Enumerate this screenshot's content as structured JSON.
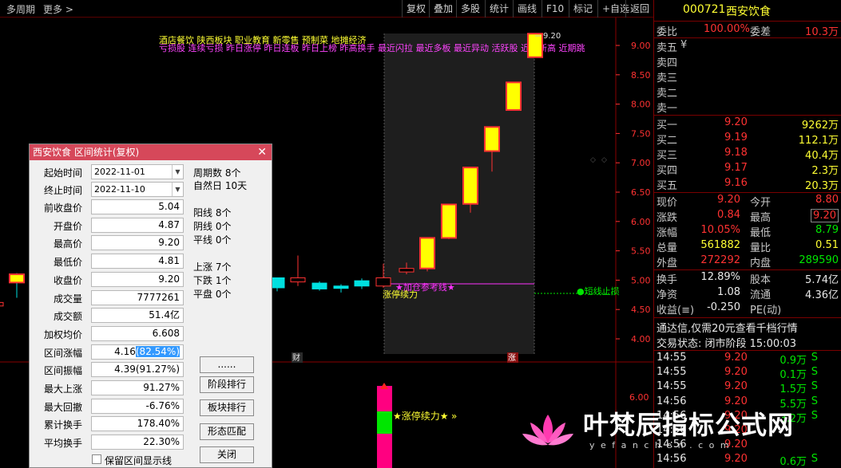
{
  "toolbar": {
    "period": "多周期",
    "more": "更多",
    "more_icon": "chevron-right-icon",
    "buttons": [
      "复权",
      "叠加",
      "多股",
      "统计",
      "画线",
      "F10",
      "标记",
      "+自选",
      "返回"
    ]
  },
  "chart": {
    "concepts": "酒店餐饮  陕西板块  职业教育 新零售 预制菜 地摊经济",
    "signals": "亏损股 连续亏损 昨日涨停 昨日连板 昨日上榜 昨高换手 最近闪拉 最近多板 最近异动 活跃股 近期新高 近期跳",
    "high_label": "9.20",
    "price_axis": [
      "9.00",
      "8.50",
      "8.00",
      "7.50",
      "7.00",
      "6.50",
      "6.00",
      "5.50",
      "5.00",
      "4.50",
      "4.00"
    ],
    "ref_line_label": "★加仓参考线★",
    "stop_label": "●短线止损",
    "limit_label": "涨停续力",
    "marker_cai": "财",
    "marker_zhang": "涨",
    "sub_axis": "6.00",
    "sub_label": "★涨停续力★",
    "sub_arrow": "»",
    "candles": [
      {
        "o": 4.56,
        "c": 4.62,
        "h": 4.62,
        "l": 4.56
      },
      {
        "o": 5.1,
        "c": 4.96,
        "h": 5.12,
        "l": 4.7
      },
      {
        "o": 5.04,
        "c": 4.87,
        "h": 5.04,
        "l": 4.81
      },
      {
        "o": 4.97,
        "c": 5.04,
        "h": 5.42,
        "l": 4.9
      },
      {
        "o": 4.95,
        "c": 4.85,
        "h": 4.98,
        "l": 4.82
      },
      {
        "o": 4.9,
        "c": 4.86,
        "h": 4.93,
        "l": 4.79
      },
      {
        "o": 4.99,
        "c": 4.9,
        "h": 5.03,
        "l": 4.85
      },
      {
        "o": 4.9,
        "c": 5.04,
        "h": 5.28,
        "l": 4.87
      },
      {
        "o": 5.14,
        "c": 5.2,
        "h": 5.3,
        "l": 5.1
      },
      {
        "o": 5.2,
        "c": 5.72,
        "h": 5.72,
        "l": 5.15
      },
      {
        "o": 5.72,
        "c": 6.29,
        "h": 6.29,
        "l": 5.7
      },
      {
        "o": 6.3,
        "c": 6.92,
        "h": 6.92,
        "l": 6.15
      },
      {
        "o": 7.2,
        "c": 7.61,
        "h": 7.61,
        "l": 6.85
      },
      {
        "o": 7.9,
        "c": 8.37,
        "h": 8.37,
        "l": 7.9
      },
      {
        "o": 8.8,
        "c": 9.2,
        "h": 9.2,
        "l": 8.79
      }
    ]
  },
  "dialog": {
    "title": "西安饮食 区间统计(复权)",
    "close_icon": "close-icon",
    "start_label": "起始时间",
    "start_value": "2022-11-01",
    "end_label": "终止时间",
    "end_value": "2022-11-10",
    "fields": [
      {
        "label": "前收盘价",
        "value": "5.04"
      },
      {
        "label": "开盘价",
        "value": "4.87"
      },
      {
        "label": "最高价",
        "value": "9.20"
      },
      {
        "label": "最低价",
        "value": "4.81"
      },
      {
        "label": "收盘价",
        "value": "9.20"
      },
      {
        "label": "成交量",
        "value": "7777261"
      },
      {
        "label": "成交额",
        "value": "51.4亿"
      },
      {
        "label": "加权均价",
        "value": "6.608"
      },
      {
        "label": "区间涨幅",
        "value": "4.16",
        "hl": "(82.54%)"
      },
      {
        "label": "区间振幅",
        "value": "4.39(91.27%)"
      },
      {
        "label": "最大上涨",
        "value": "91.27%"
      },
      {
        "label": "最大回撤",
        "value": "-6.76%"
      },
      {
        "label": "累计换手",
        "value": "178.40%"
      },
      {
        "label": "平均换手",
        "value": "22.30%"
      }
    ],
    "periods": "周期数 8个",
    "natural_days": "自然日 10天",
    "yang": "阳线 8个",
    "yin": "阴线 0个",
    "ping": "平线 0个",
    "up": "上涨 7个",
    "down": "下跌 1个",
    "flat": "平盘 0个",
    "btn_more": "......",
    "btn_rank": "阶段排行",
    "btn_sector": "板块排行",
    "btn_pattern": "形态匹配",
    "btn_close": "关闭",
    "keep_label": "保留区间显示线"
  },
  "quote": {
    "code": "000721",
    "name": "西安饮食",
    "weibi_label": "委比",
    "weibi": "100.00%",
    "weicha_label": "委差",
    "weicha": "10.3万",
    "sells": [
      {
        "label": "卖五",
        "extra": "¥"
      },
      {
        "label": "卖四"
      },
      {
        "label": "卖三"
      },
      {
        "label": "卖二"
      },
      {
        "label": "卖一"
      }
    ],
    "buys": [
      {
        "label": "买一",
        "price": "9.20",
        "vol": "9262万"
      },
      {
        "label": "买二",
        "price": "9.19",
        "vol": "112.1万"
      },
      {
        "label": "买三",
        "price": "9.18",
        "vol": "40.4万"
      },
      {
        "label": "买四",
        "price": "9.17",
        "vol": "2.3万"
      },
      {
        "label": "买五",
        "price": "9.16",
        "vol": "20.3万"
      }
    ],
    "stats": [
      {
        "l1": "现价",
        "v1": "9.20",
        "l2": "今开",
        "v2": "8.80"
      },
      {
        "l1": "涨跌",
        "v1": "0.84",
        "l2": "最高",
        "v2": "9.20"
      },
      {
        "l1": "涨幅",
        "v1": "10.05%",
        "l2": "最低",
        "v2": "8.79"
      },
      {
        "l1": "总量",
        "v1": "561882",
        "l2": "量比",
        "v2": "0.51"
      },
      {
        "l1": "外盘",
        "v1": "272292",
        "l2": "内盘",
        "v2": "289590"
      }
    ],
    "stats2": [
      {
        "l1": "换手",
        "v1": "12.89%",
        "l2": "股本",
        "v2": "5.74亿"
      },
      {
        "l1": "净资",
        "v1": "1.08",
        "l2": "流通",
        "v2": "4.36亿"
      },
      {
        "l1": "收益(≡)",
        "v1": "-0.250",
        "l2": "PE(动)",
        "v2": ""
      }
    ],
    "promo": "通达信,仅需20元查看千档行情",
    "status": "交易状态: 闭市阶段 15:00:03",
    "ticks": [
      {
        "t": "14:55",
        "p": "9.20",
        "v": "0.9万",
        "s": "S"
      },
      {
        "t": "14:55",
        "p": "9.20",
        "v": "0.1万",
        "s": "S"
      },
      {
        "t": "14:55",
        "p": "9.20",
        "v": "1.5万",
        "s": "S"
      },
      {
        "t": "14:56",
        "p": "9.20",
        "v": "5.5万",
        "s": "S"
      },
      {
        "t": "14:56",
        "p": "9.20",
        "v": "3.2万",
        "s": "S"
      },
      {
        "t": "14:56",
        "p": "9.20",
        "v": "",
        "s": ""
      },
      {
        "t": "14:56",
        "p": "9.20",
        "v": "",
        "s": ""
      },
      {
        "t": "14:56",
        "p": "9.20",
        "v": "0.6万",
        "s": "S"
      }
    ]
  },
  "watermark": {
    "text": "叶梵辰指标公式网",
    "url": "y e f a n c h e n . c o m",
    "logo": "lotus-logo"
  }
}
